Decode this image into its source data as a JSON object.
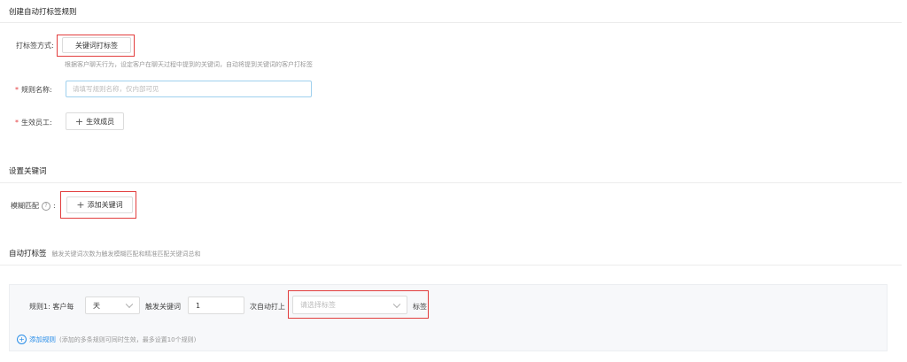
{
  "section1": {
    "title": "创建自动打标签规则",
    "method_label": "打标签方式:",
    "method_button": "关键词打标签",
    "method_hint": "根据客户聊天行为，设定客户在聊天过程中提到的关键词，自动将提到关键词的客户打标签",
    "rule_name_label": "规则名称:",
    "rule_name_placeholder": "请填写规则名称，仅内部可见",
    "staff_label": "生效员工:",
    "staff_button": "生效成员",
    "required_mark": "*"
  },
  "section2": {
    "title": "设置关键词",
    "fuzzy_label": "模糊匹配",
    "fuzzy_colon": ":",
    "help_icon": "?",
    "add_keyword_button": "添加关键词"
  },
  "section3": {
    "title": "自动打标签",
    "subtitle": "触发关键词次数为触发模糊匹配和精准匹配关键词总和",
    "rule_prefix": "规则1: 客户每",
    "period_value": "天",
    "trigger_text": "触发关键词",
    "count_value": "1",
    "auto_text": "次自动打上",
    "tag_placeholder": "请选择标签",
    "tag_suffix": "标签",
    "add_rule_label": "添加规则",
    "add_rule_hint": "(添加的多条规则可同时生效，最多设置10个规则)"
  },
  "icons": {
    "plus": "plus-icon",
    "chevron": "chevron-down-icon",
    "help": "help-circle-icon",
    "add_circle": "add-circle-icon"
  },
  "colors": {
    "accent": "#2a8ee8",
    "highlight_box": "#e23d3d",
    "required": "#e4393c"
  }
}
